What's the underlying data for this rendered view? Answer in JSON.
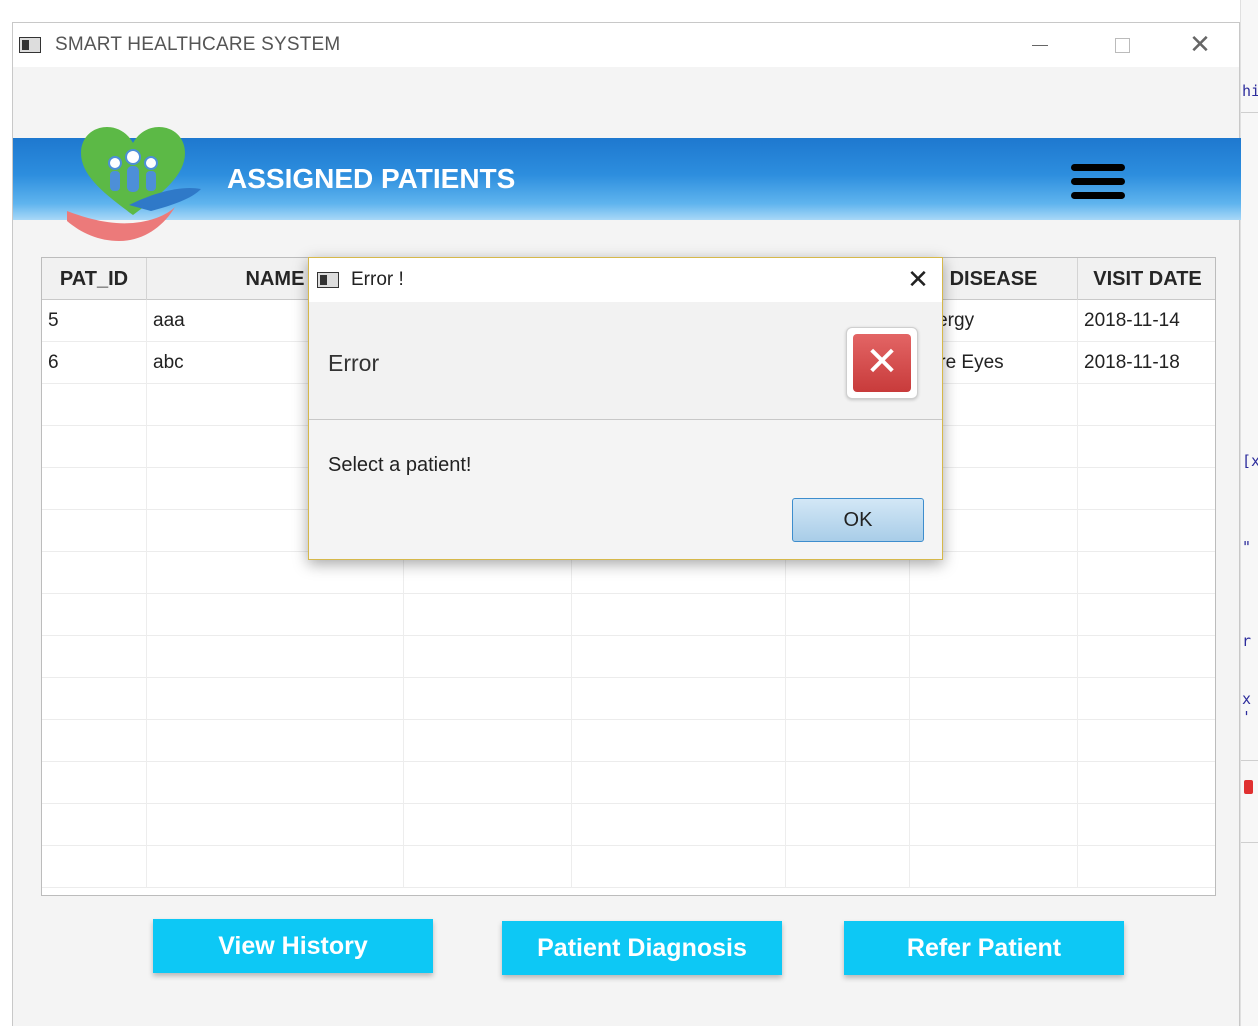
{
  "window": {
    "title": "SMART HEALTHCARE SYSTEM",
    "close_glyph": "✕"
  },
  "header": {
    "title": "ASSIGNED PATIENTS",
    "banner_color": "#2d8ede"
  },
  "table": {
    "columns": [
      "PAT_ID",
      "NAME",
      "",
      "",
      "",
      "DISEASE",
      "VISIT DATE"
    ],
    "rows": [
      [
        "5",
        "aaa",
        "",
        "",
        "",
        "Allergy",
        "2018-11-14"
      ],
      [
        "6",
        "abc",
        "",
        "",
        "",
        "Sore Eyes",
        "2018-11-18"
      ]
    ],
    "empty_rows": 12
  },
  "buttons": {
    "view_history": "View History",
    "patient_diagnosis": "Patient Diagnosis",
    "refer_patient": "Refer Patient",
    "color": "#0dc8f5"
  },
  "dialog": {
    "title": "Error !",
    "header": "Error",
    "message": "Select a patient!",
    "ok": "OK",
    "close_glyph": "✕",
    "error_glyph": "✕"
  },
  "background_editor": {
    "fragments": [
      "hir",
      "[x",
      "\"",
      "r",
      "x",
      "'"
    ]
  }
}
